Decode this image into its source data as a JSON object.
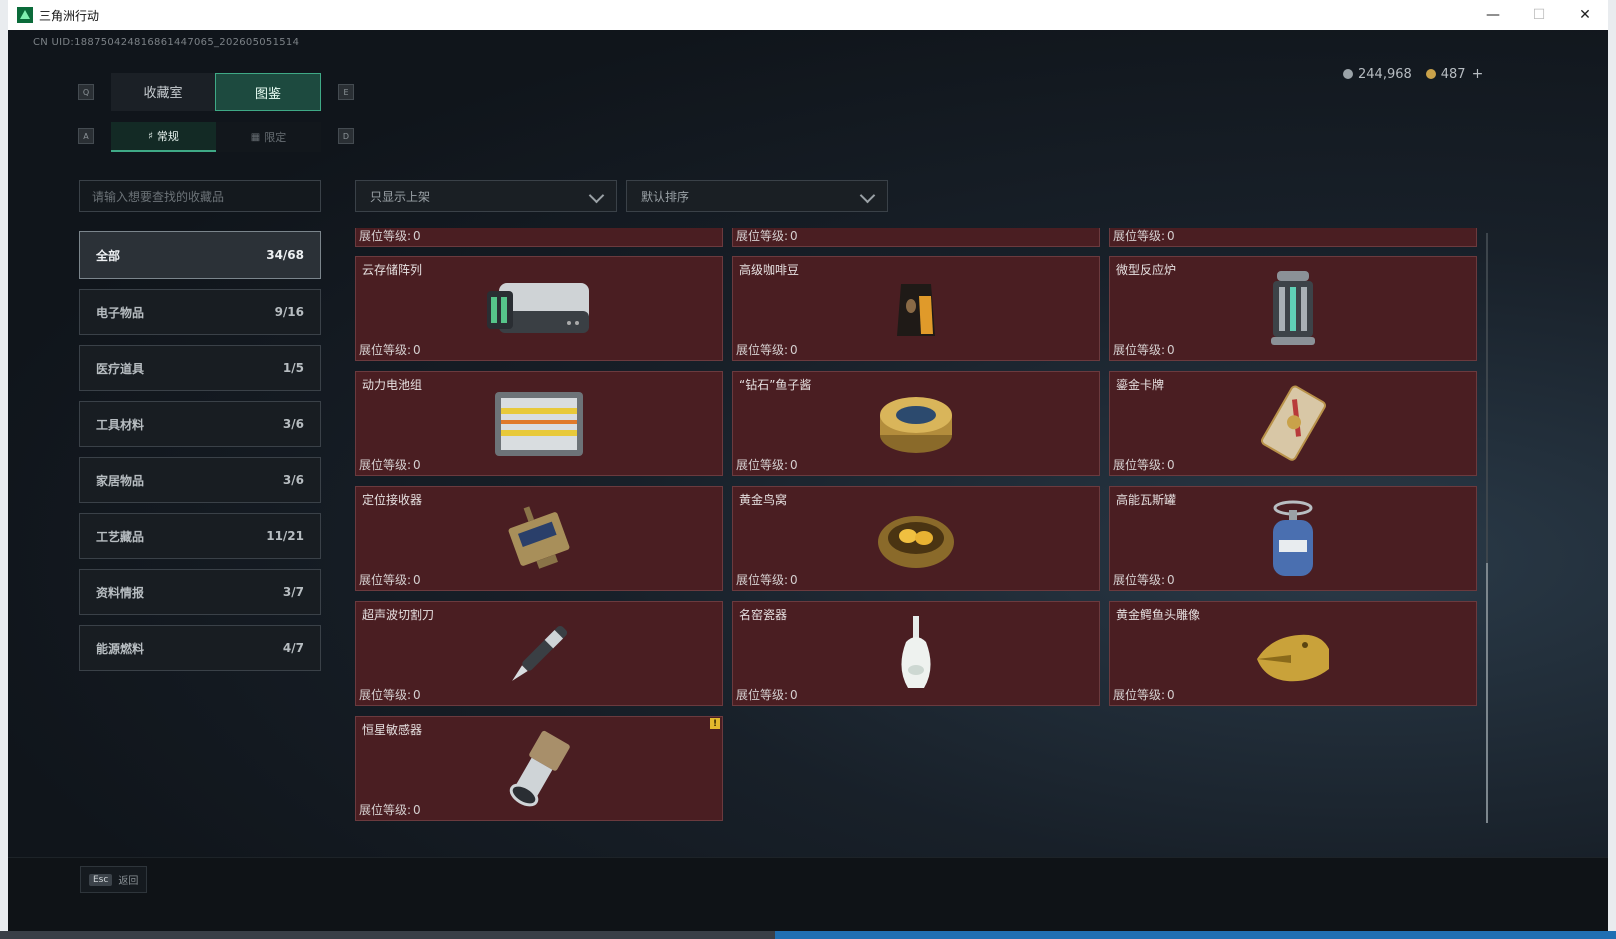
{
  "window": {
    "title": "三角洲行动"
  },
  "uid": "CN UID:188750424816861447065_202605051514",
  "currency": {
    "silver": "244,968",
    "gold": "487",
    "add": "+"
  },
  "keys": {
    "prev_tab": "Q",
    "next_tab": "E",
    "prev_sub": "A",
    "next_sub": "D"
  },
  "tabs": [
    {
      "label": "收藏室"
    },
    {
      "label": "图鉴"
    }
  ],
  "subtabs": [
    {
      "label": "常规"
    },
    {
      "label": "限定"
    }
  ],
  "search": {
    "placeholder": "请输入想要查找的收藏品"
  },
  "filters": {
    "shelf": "只显示上架",
    "sort": "默认排序"
  },
  "categories": [
    {
      "name": "全部",
      "count": "34/68"
    },
    {
      "name": "电子物品",
      "count": "9/16"
    },
    {
      "name": "医疗道具",
      "count": "1/5"
    },
    {
      "name": "工具材料",
      "count": "3/6"
    },
    {
      "name": "家居物品",
      "count": "3/6"
    },
    {
      "name": "工艺藏品",
      "count": "11/21"
    },
    {
      "name": "资料情报",
      "count": "3/7"
    },
    {
      "name": "能源燃料",
      "count": "4/7"
    }
  ],
  "level_label": "展位等级:",
  "cards": [
    {
      "name": "",
      "level": "0",
      "icon": "partial-item"
    },
    {
      "name": "",
      "level": "0",
      "icon": "partial-item"
    },
    {
      "name": "",
      "level": "0",
      "icon": "partial-item"
    },
    {
      "name": "云存储阵列",
      "level": "0",
      "icon": "server-icon"
    },
    {
      "name": "高级咖啡豆",
      "level": "0",
      "icon": "coffee-bag-icon"
    },
    {
      "name": "微型反应炉",
      "level": "0",
      "icon": "reactor-icon"
    },
    {
      "name": "动力电池组",
      "level": "0",
      "icon": "battery-pack-icon"
    },
    {
      "name": "“钻石”鱼子酱",
      "level": "0",
      "icon": "caviar-tin-icon"
    },
    {
      "name": "鎏金卡牌",
      "level": "0",
      "icon": "gold-card-icon"
    },
    {
      "name": "定位接收器",
      "level": "0",
      "icon": "gps-receiver-icon"
    },
    {
      "name": "黄金鸟窝",
      "level": "0",
      "icon": "golden-nest-icon"
    },
    {
      "name": "高能瓦斯罐",
      "level": "0",
      "icon": "gas-canister-icon"
    },
    {
      "name": "超声波切割刀",
      "level": "0",
      "icon": "ultrasonic-cutter-icon"
    },
    {
      "name": "名窑瓷器",
      "level": "0",
      "icon": "porcelain-vase-icon"
    },
    {
      "name": "黄金鳄鱼头雕像",
      "level": "0",
      "icon": "gold-croc-statue-icon"
    },
    {
      "name": "恒星敏感器",
      "level": "0",
      "icon": "star-sensor-icon",
      "badge": "!"
    }
  ],
  "footer": {
    "esc_key": "Esc",
    "back": "返回"
  },
  "colors": {
    "accent": "#3fa986",
    "card_bg": "#4a1e22",
    "card_border": "#6b3a3e"
  }
}
